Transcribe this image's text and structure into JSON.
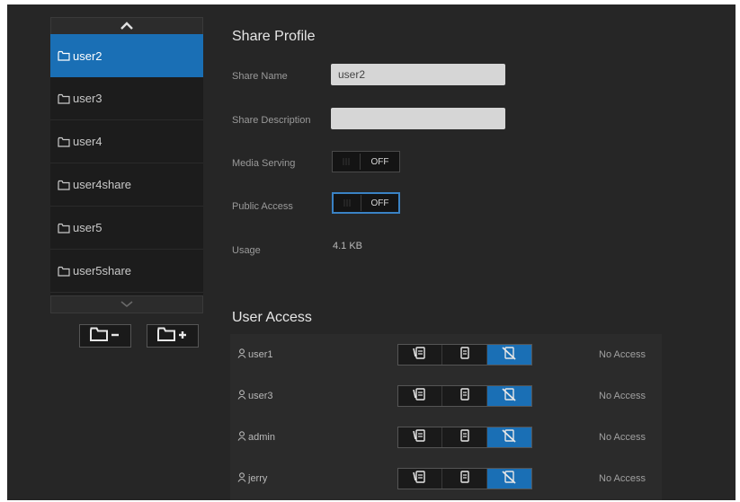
{
  "colors": {
    "accent": "#1a6fb5",
    "panel": "#262626",
    "list_bg": "#1c1c1c",
    "field_bg": "#d6d6d6"
  },
  "sidebar": {
    "items": [
      {
        "label": "user2",
        "selected": true,
        "icon": "folder-icon"
      },
      {
        "label": "user3",
        "selected": false,
        "icon": "folder-icon"
      },
      {
        "label": "user4",
        "selected": false,
        "icon": "folder-icon"
      },
      {
        "label": "user4share",
        "selected": false,
        "icon": "folder-icon"
      },
      {
        "label": "user5",
        "selected": false,
        "icon": "folder-icon"
      },
      {
        "label": "user5share",
        "selected": false,
        "icon": "folder-icon"
      }
    ],
    "scroll_up_icon": "chevron-up-icon",
    "scroll_down_icon": "chevron-down-icon",
    "remove_share_icon": "folder-minus-icon",
    "add_share_icon": "folder-plus-icon"
  },
  "profile": {
    "title": "Share Profile",
    "share_name_label": "Share Name",
    "share_name_value": "user2",
    "share_description_label": "Share Description",
    "share_description_value": "",
    "media_serving_label": "Media Serving",
    "media_serving_state": "OFF",
    "public_access_label": "Public Access",
    "public_access_state": "OFF",
    "usage_label": "Usage",
    "usage_value": "4.1 KB"
  },
  "user_access": {
    "title": "User Access",
    "permission_icons": [
      "read-write-icon",
      "read-only-icon",
      "no-access-icon"
    ],
    "users": [
      {
        "name": "user1",
        "access": "No Access",
        "active_permission": 2
      },
      {
        "name": "user3",
        "access": "No Access",
        "active_permission": 2
      },
      {
        "name": "admin",
        "access": "No Access",
        "active_permission": 2
      },
      {
        "name": "jerry",
        "access": "No Access",
        "active_permission": 2
      }
    ]
  }
}
